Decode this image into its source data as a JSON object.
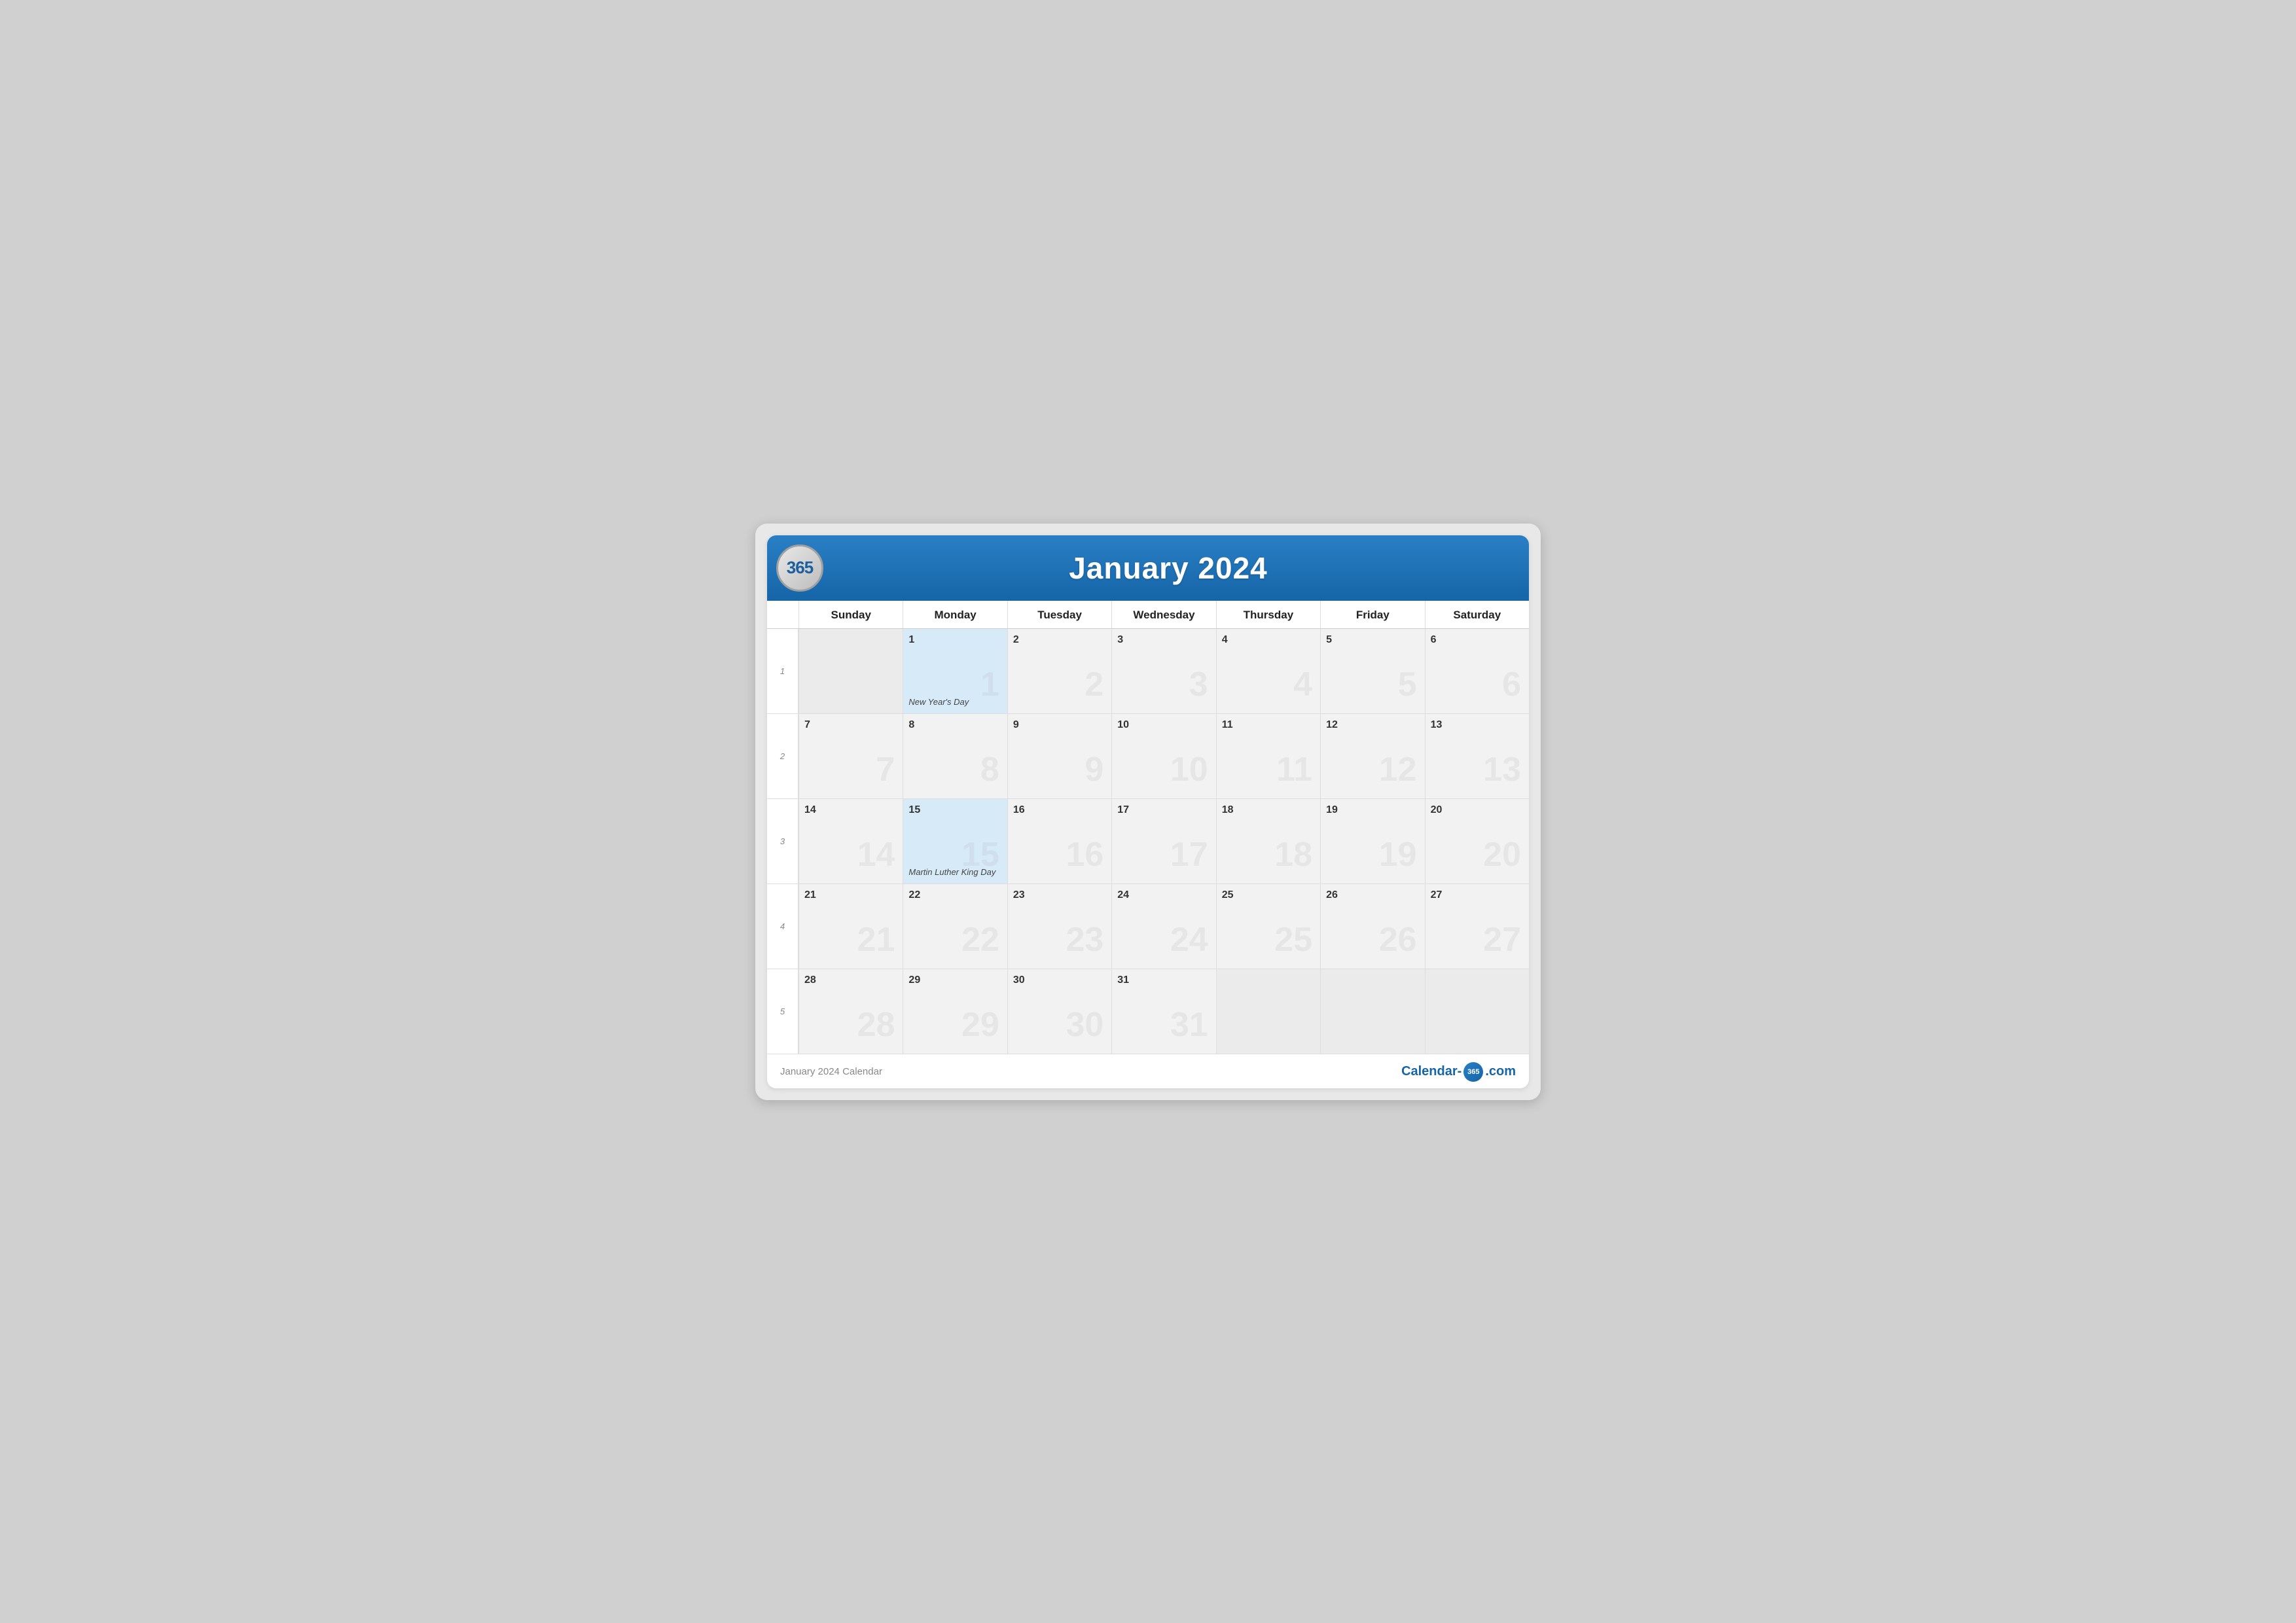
{
  "header": {
    "logo": "365",
    "title": "January 2024"
  },
  "footer": {
    "label": "January 2024 Calendar",
    "brand_prefix": "Calendar-",
    "brand_365": "365",
    "brand_suffix": ".com"
  },
  "days_of_week": [
    "Sunday",
    "Monday",
    "Tuesday",
    "Wednesday",
    "Thursday",
    "Friday",
    "Saturday"
  ],
  "week_numbers": [
    "1",
    "2",
    "3",
    "4",
    "5"
  ],
  "weeks": [
    {
      "week": "1",
      "days": [
        {
          "date": "",
          "outside": true,
          "holiday": false,
          "holiday_name": ""
        },
        {
          "date": "1",
          "outside": false,
          "holiday": true,
          "holiday_name": "New Year's Day"
        },
        {
          "date": "2",
          "outside": false,
          "holiday": false,
          "holiday_name": ""
        },
        {
          "date": "3",
          "outside": false,
          "holiday": false,
          "holiday_name": ""
        },
        {
          "date": "4",
          "outside": false,
          "holiday": false,
          "holiday_name": ""
        },
        {
          "date": "5",
          "outside": false,
          "holiday": false,
          "holiday_name": ""
        },
        {
          "date": "6",
          "outside": false,
          "holiday": false,
          "holiday_name": ""
        }
      ]
    },
    {
      "week": "2",
      "days": [
        {
          "date": "7",
          "outside": false,
          "holiday": false,
          "holiday_name": ""
        },
        {
          "date": "8",
          "outside": false,
          "holiday": false,
          "holiday_name": ""
        },
        {
          "date": "9",
          "outside": false,
          "holiday": false,
          "holiday_name": ""
        },
        {
          "date": "10",
          "outside": false,
          "holiday": false,
          "holiday_name": ""
        },
        {
          "date": "11",
          "outside": false,
          "holiday": false,
          "holiday_name": ""
        },
        {
          "date": "12",
          "outside": false,
          "holiday": false,
          "holiday_name": ""
        },
        {
          "date": "13",
          "outside": false,
          "holiday": false,
          "holiday_name": ""
        }
      ]
    },
    {
      "week": "3",
      "days": [
        {
          "date": "14",
          "outside": false,
          "holiday": false,
          "holiday_name": ""
        },
        {
          "date": "15",
          "outside": false,
          "holiday": true,
          "holiday_name": "Martin Luther King Day"
        },
        {
          "date": "16",
          "outside": false,
          "holiday": false,
          "holiday_name": ""
        },
        {
          "date": "17",
          "outside": false,
          "holiday": false,
          "holiday_name": ""
        },
        {
          "date": "18",
          "outside": false,
          "holiday": false,
          "holiday_name": ""
        },
        {
          "date": "19",
          "outside": false,
          "holiday": false,
          "holiday_name": ""
        },
        {
          "date": "20",
          "outside": false,
          "holiday": false,
          "holiday_name": ""
        }
      ]
    },
    {
      "week": "4",
      "days": [
        {
          "date": "21",
          "outside": false,
          "holiday": false,
          "holiday_name": ""
        },
        {
          "date": "22",
          "outside": false,
          "holiday": false,
          "holiday_name": ""
        },
        {
          "date": "23",
          "outside": false,
          "holiday": false,
          "holiday_name": ""
        },
        {
          "date": "24",
          "outside": false,
          "holiday": false,
          "holiday_name": ""
        },
        {
          "date": "25",
          "outside": false,
          "holiday": false,
          "holiday_name": ""
        },
        {
          "date": "26",
          "outside": false,
          "holiday": false,
          "holiday_name": ""
        },
        {
          "date": "27",
          "outside": false,
          "holiday": false,
          "holiday_name": ""
        }
      ]
    },
    {
      "week": "5",
      "days": [
        {
          "date": "28",
          "outside": false,
          "holiday": false,
          "holiday_name": ""
        },
        {
          "date": "29",
          "outside": false,
          "holiday": false,
          "holiday_name": ""
        },
        {
          "date": "30",
          "outside": false,
          "holiday": false,
          "holiday_name": ""
        },
        {
          "date": "31",
          "outside": false,
          "holiday": false,
          "holiday_name": ""
        },
        {
          "date": "",
          "outside": true,
          "holiday": false,
          "holiday_name": ""
        },
        {
          "date": "",
          "outside": true,
          "holiday": false,
          "holiday_name": ""
        },
        {
          "date": "",
          "outside": true,
          "holiday": false,
          "holiday_name": ""
        }
      ]
    }
  ]
}
